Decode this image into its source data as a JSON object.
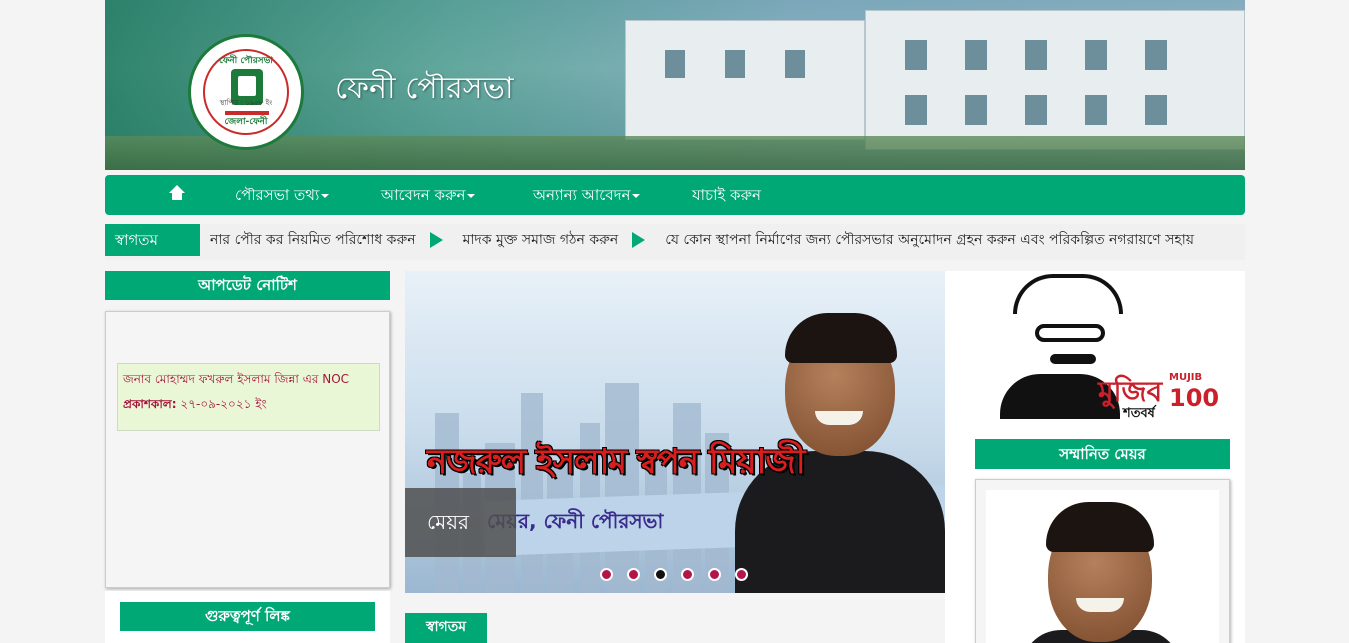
{
  "header": {
    "site_title": "ফেনী পৌরসভা",
    "logo": {
      "top_text": "ফেনী পৌরসভা",
      "established": "স্থাপিত : ১৯৫৮ ইং",
      "bottom_text": "জেলা-ফেনী"
    }
  },
  "nav": {
    "home_icon": "home-icon",
    "items": [
      {
        "label": "পৌরসভা তথ্য",
        "dropdown": true
      },
      {
        "label": "আবেদন করুন",
        "dropdown": true
      },
      {
        "label": "অন্যান্য আবেদন",
        "dropdown": true
      },
      {
        "label": "যাচাই করুন",
        "dropdown": false
      }
    ]
  },
  "ticker": {
    "label": "স্বাগতম",
    "messages": [
      "নার পৌর কর নিয়মিত পরিশোধ করুন",
      "মাদক মুক্ত সমাজ গঠন করুন",
      "যে কোন স্থাপনা নির্মাণের জন্য পৌরসভার অনুমোদন গ্রহন করুন এবং পরিকল্পিত নগরায়ণে সহায়"
    ]
  },
  "left": {
    "notice_title": "আপডেট নোটিশ",
    "notice": {
      "title": "জনাব মোহাম্মদ ফখরুল ইসলাম জিন্না এর NOC",
      "date_label": "প্রকাশকাল:",
      "date_value": "২৭-০৯-২০২১ ইং"
    },
    "links_title": "গুরুত্বপূর্ণ লিঙ্ক"
  },
  "slider": {
    "name": "নজরুল ইসলাম স্বপন মিয়াজী",
    "role": "মেয়র, ফেনী পৌরসভা",
    "caption": "মেয়র",
    "slide_count": 6,
    "active_index": 2
  },
  "main": {
    "welcome_tab": "স্বাগতম"
  },
  "right": {
    "mujib": {
      "bn_title": "মুজিব",
      "bn_sub": "শতবর্ষ",
      "en_title": "MUJIB",
      "en_num": "100"
    },
    "mayor_title": "সম্মানিত মেয়র"
  },
  "colors": {
    "primary_green": "#00a876",
    "notice_text": "#a4153a",
    "dot": "#b3154a"
  }
}
